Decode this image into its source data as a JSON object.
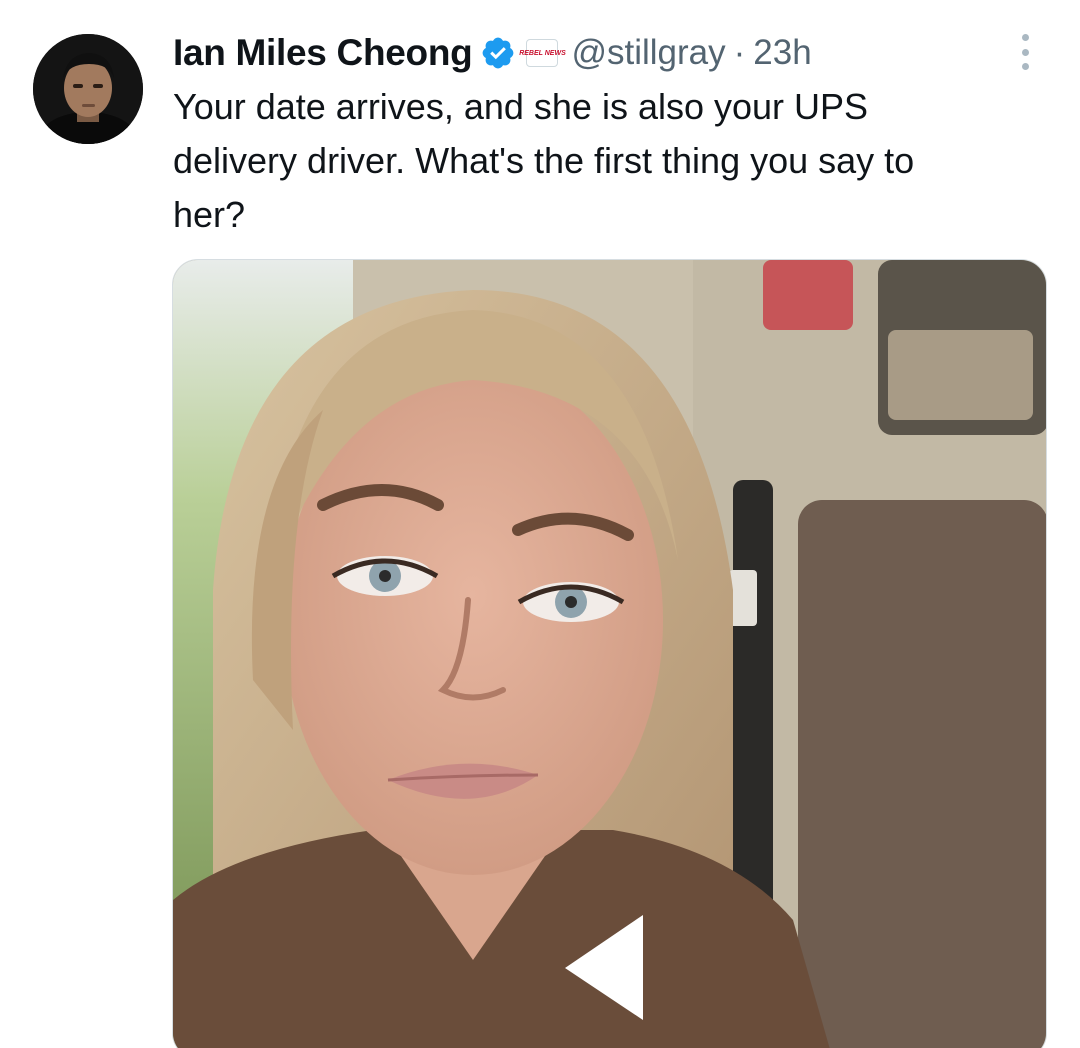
{
  "tweet": {
    "author": {
      "display_name": "Ian Miles Cheong",
      "handle": "@stillgray",
      "verified_icon": "verified-badge-icon",
      "affiliate_badge": "REBEL NEWS",
      "avatar_icon": "avatar-photo"
    },
    "separator": "·",
    "timestamp": "23h",
    "text": "Your date arrives, and she is also your UPS\ndelivery driver. What's the first thing you say to\nher?",
    "more_icon": "more-options-icon",
    "media": {
      "type": "video",
      "play_icon": "play-icon"
    }
  },
  "colors": {
    "text_primary": "#0f1419",
    "text_secondary": "#536471",
    "verified_blue": "#1d9bf0",
    "border": "#d6dde1"
  }
}
